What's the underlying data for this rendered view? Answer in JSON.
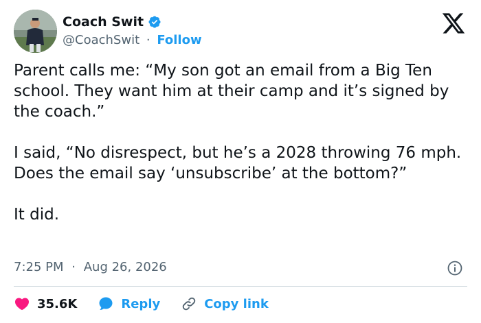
{
  "author": {
    "display_name": "Coach Swit",
    "handle": "@CoachSwit",
    "separator": "·",
    "follow_label": "Follow",
    "avatar_icon": "profile-photo-baseball",
    "verified_icon": "verified-badge-icon"
  },
  "brand": {
    "logo_icon": "x-logo-icon"
  },
  "tweet": {
    "paragraphs": [
      "Parent calls me: “My son got an email from a Big Ten school. They want him at their camp and it’s signed by the coach.”",
      "I said, “No disrespect, but he’s a 2028 throwing 76 mph. Does the email say ‘unsubscribe’ at the bottom?”",
      "It did."
    ]
  },
  "meta": {
    "time": "7:25 PM",
    "separator": "·",
    "date": "Aug 26, 2026",
    "info_icon": "info-icon"
  },
  "actions": {
    "likes_count": "35.6K",
    "reply_label": "Reply",
    "copy_link_label": "Copy link"
  },
  "colors": {
    "accent": "#1d9bf0",
    "like": "#f91880",
    "text": "#0f1419",
    "muted": "#536471"
  }
}
